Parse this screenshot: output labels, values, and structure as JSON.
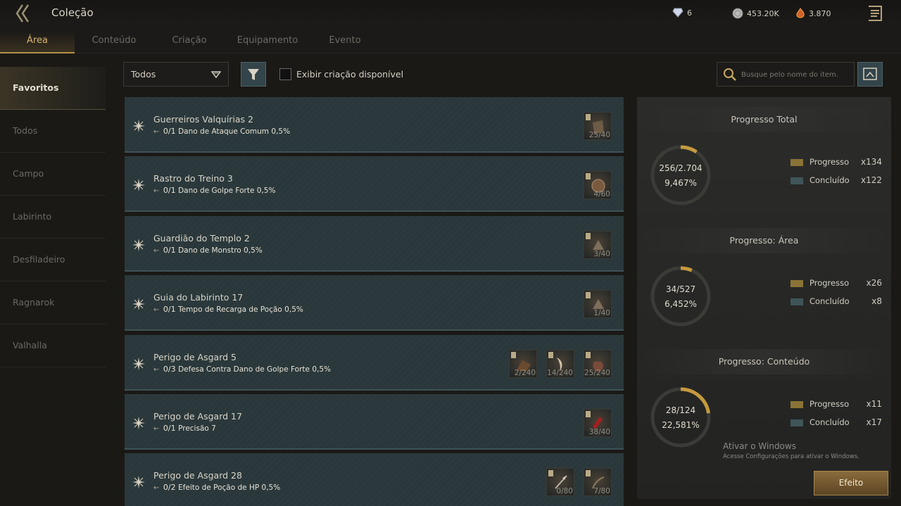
{
  "header": {
    "title": "Coleção",
    "currencies": [
      {
        "icon": "diamond-icon",
        "value": "6"
      },
      {
        "icon": "silver-coin-icon",
        "value": "453.20K"
      },
      {
        "icon": "flame-gem-icon",
        "value": "3.870"
      }
    ]
  },
  "tabs": [
    {
      "label": "Área",
      "active": true
    },
    {
      "label": "Conteúdo"
    },
    {
      "label": "Criação"
    },
    {
      "label": "Equipamento"
    },
    {
      "label": "Evento"
    }
  ],
  "sidebar": {
    "items": [
      {
        "label": "Favoritos",
        "active": true
      },
      {
        "label": "Todos"
      },
      {
        "label": "Campo"
      },
      {
        "label": "Labirinto"
      },
      {
        "label": "Desfiladeiro"
      },
      {
        "label": "Ragnarok"
      },
      {
        "label": "Valhalla"
      }
    ]
  },
  "filters": {
    "select_value": "Todos",
    "checkbox_label": "Exibir criação disponível",
    "search_placeholder": "Busque pelo nome do item."
  },
  "collections": [
    {
      "name": "Guerreiros Valquírias 2",
      "effect": "0/1",
      "effect_text": "Dano de Ataque Comum 0,5%",
      "items": [
        {
          "count": "25/40",
          "icon": "cloth-item-icon"
        }
      ]
    },
    {
      "name": "Rastro do Treino 3",
      "effect": "0/1",
      "effect_text": "Dano de Golpe Forte 0,5%",
      "items": [
        {
          "count": "4/60",
          "icon": "shield-item-icon"
        }
      ]
    },
    {
      "name": "Guardião do Templo 2",
      "effect": "0/1",
      "effect_text": "Dano de Monstro 0,5%",
      "items": [
        {
          "count": "3/40",
          "icon": "horn-item-icon"
        }
      ]
    },
    {
      "name": "Guia do Labirinto 17",
      "effect": "0/1",
      "effect_text": "Tempo de Recarga de Poção 0,5%",
      "items": [
        {
          "count": "1/40",
          "icon": "horn-item-icon"
        }
      ]
    },
    {
      "name": "Perigo de Asgard 5",
      "effect": "0/3",
      "effect_text": "Defesa Contra Dano de Golpe Forte 0,5%",
      "items": [
        {
          "count": "2/240",
          "icon": "hide-item-icon"
        },
        {
          "count": "14/240",
          "icon": "fang-item-icon"
        },
        {
          "count": "25/240",
          "icon": "pouch-item-icon"
        }
      ]
    },
    {
      "name": "Perigo de Asgard 17",
      "effect": "0/1",
      "effect_text": "Precisão 7",
      "items": [
        {
          "count": "38/40",
          "icon": "potion-item-icon"
        }
      ]
    },
    {
      "name": "Perigo de Asgard 28",
      "effect": "0/2",
      "effect_text": "Efeito de Poção de HP 0,5%",
      "items": [
        {
          "count": "0/80",
          "icon": "spear-item-icon"
        },
        {
          "count": "7/80",
          "icon": "bow-item-icon"
        }
      ]
    }
  ],
  "progress": [
    {
      "title": "Progresso Total",
      "value": "256/2.704",
      "percent": "9,467%",
      "fraction": 0.09467,
      "progress_label": "Progresso",
      "progress_count": "x134",
      "done_label": "Concluído",
      "done_count": "x122"
    },
    {
      "title": "Progresso: Área",
      "value": "34/527",
      "percent": "6,452%",
      "fraction": 0.06452,
      "progress_label": "Progresso",
      "progress_count": "x26",
      "done_label": "Concluído",
      "done_count": "x8"
    },
    {
      "title": "Progresso: Conteúdo",
      "value": "28/124",
      "percent": "22,581%",
      "fraction": 0.22581,
      "progress_label": "Progresso",
      "progress_count": "x11",
      "done_label": "Concluído",
      "done_count": "x17"
    }
  ],
  "watermark": {
    "title": "Ativar o Windows",
    "subtitle": "Acesse Configurações para ativar o Windows."
  },
  "effect_button": "Efeito",
  "colors": {
    "accent": "#b58f47",
    "ring_progress": "#c49a3e",
    "ring_track": "#3b3b37",
    "legend_progress": "#8a7336",
    "legend_done": "#3f5558"
  }
}
